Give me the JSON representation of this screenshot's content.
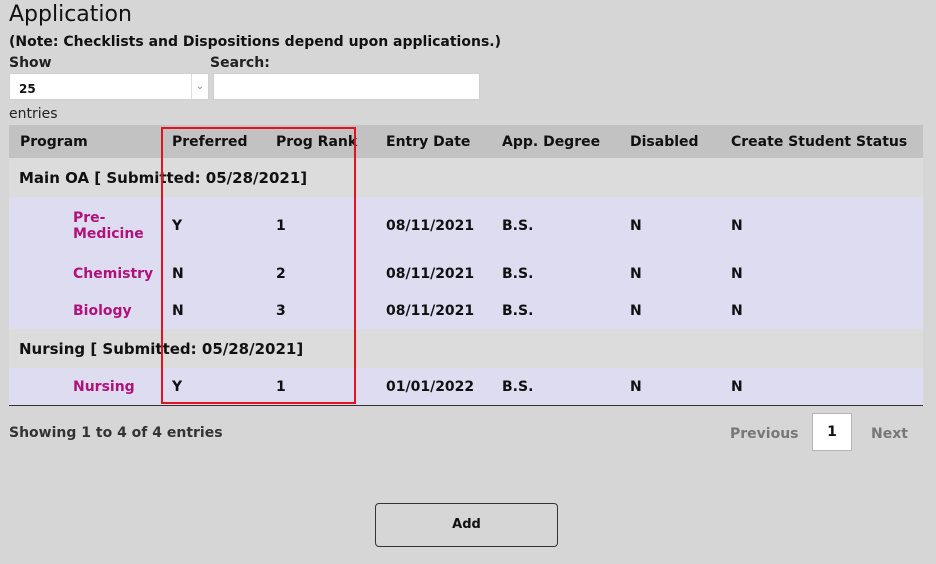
{
  "page": {
    "title": "Application",
    "note": "(Note: Checklists and Dispositions depend upon applications.)"
  },
  "controls": {
    "show_label": "Show",
    "show_value": "25",
    "entries_label": "entries",
    "search_label": "Search:",
    "search_value": ""
  },
  "table": {
    "headers": [
      "Program",
      "Preferred",
      "Prog Rank",
      "Entry Date",
      "App. Degree",
      "Disabled",
      "Create Student Status"
    ],
    "groups": [
      {
        "label": "Main OA [ Submitted: 05/28/2021]",
        "rows": [
          {
            "program": "Pre-\nMedicine",
            "preferred": "Y",
            "rank": "1",
            "entry_date": "08/11/2021",
            "degree": "B.S.",
            "disabled": "N",
            "status": "N"
          },
          {
            "program": "Chemistry",
            "preferred": "N",
            "rank": "2",
            "entry_date": "08/11/2021",
            "degree": "B.S.",
            "disabled": "N",
            "status": "N"
          },
          {
            "program": "Biology",
            "preferred": "N",
            "rank": "3",
            "entry_date": "08/11/2021",
            "degree": "B.S.",
            "disabled": "N",
            "status": "N"
          }
        ]
      },
      {
        "label": "Nursing [ Submitted: 05/28/2021]",
        "rows": [
          {
            "program": "Nursing",
            "preferred": "Y",
            "rank": "1",
            "entry_date": "01/01/2022",
            "degree": "B.S.",
            "disabled": "N",
            "status": "N"
          }
        ]
      }
    ]
  },
  "footer": {
    "info": "Showing 1 to 4 of 4 entries",
    "previous": "Previous",
    "page": "1",
    "next": "Next"
  },
  "actions": {
    "add_label": "Add"
  },
  "colors": {
    "program_link": "#b0127a",
    "highlight_box": "#e0141e"
  }
}
